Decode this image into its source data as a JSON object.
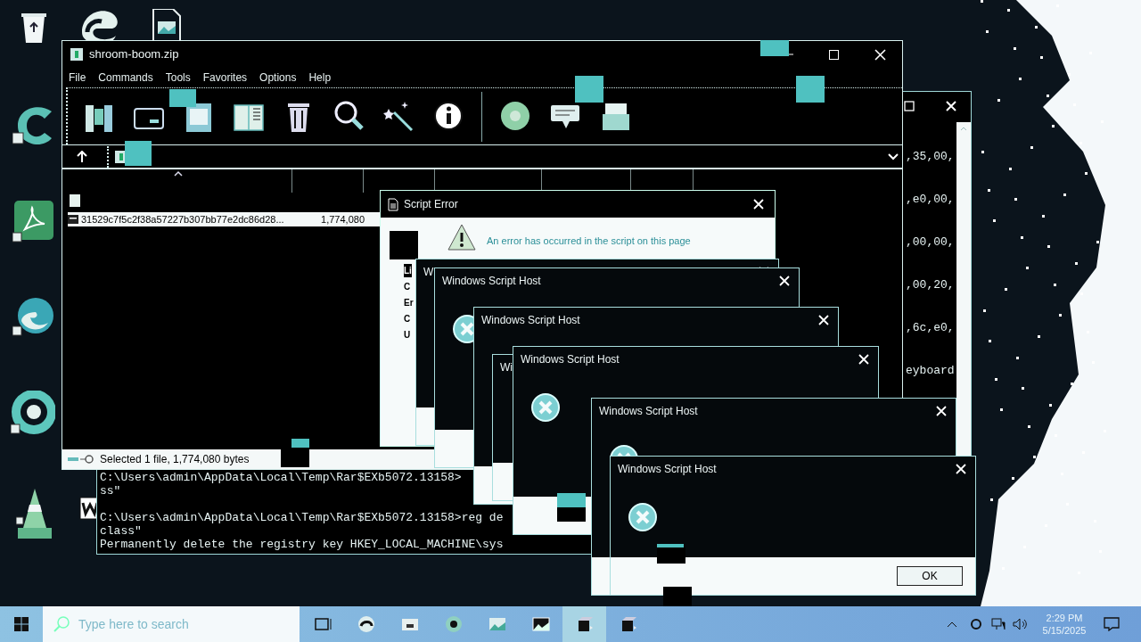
{
  "console": {
    "hex_column": [
      ",35,00,",
      ",e0,00,",
      ",00,00,",
      ",00,20,",
      ",6c,e0,",
      "eyboard"
    ],
    "blocks": [
      [
        "C:\\Users\\admin\\AppData\\Local\\Temp\\Rar$EXb5072.13158>",
        "ss\""
      ],
      [
        "C:\\Users\\admin\\AppData\\Local\\Temp\\Rar$EXb5072.13158>reg de",
        "class\"",
        "Permanently delete the registry key HKEY_LOCAL_MACHINE\\sys"
      ]
    ]
  },
  "archiver": {
    "title": "shroom-boom.zip",
    "menu": [
      "File",
      "Commands",
      "Tools",
      "Favorites",
      "Options",
      "Help"
    ],
    "files": [
      {
        "name": "31529c7f5c2f38a57227b307bb77e2dc86d28...",
        "size": "1,774,080",
        "selected": true
      }
    ],
    "status": "Selected 1 file, 1,774,080 bytes"
  },
  "script_error": {
    "title": "Script Error",
    "message": "An error has occurred in the script on this page",
    "labels": [
      "Li",
      "C",
      "Er",
      "C",
      "U"
    ]
  },
  "script_host_dialogs": [
    {
      "title": "W"
    },
    {
      "title": "Windows Script Host"
    },
    {
      "title": "Windows Script Host"
    },
    {
      "title": "Wi"
    },
    {
      "title": "Windows Script Host"
    },
    {
      "title": "Windows Script Host"
    },
    {
      "title": "Windows Script Host",
      "button": "OK"
    }
  ],
  "taskbar": {
    "search_placeholder": "Type here to search",
    "time": "2:29 PM",
    "date": "5/15/2025"
  }
}
